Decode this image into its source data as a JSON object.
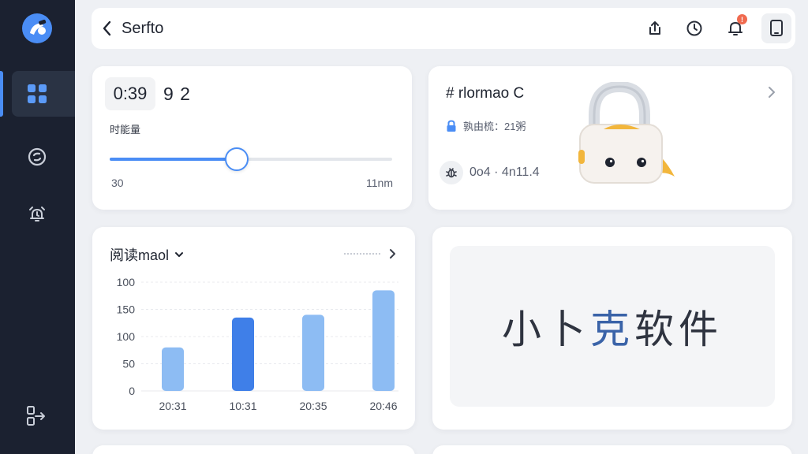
{
  "header": {
    "title": "Serfto",
    "notification_badge": "!"
  },
  "timer_card": {
    "time_main": "0:39",
    "time_extra": "9 2",
    "label": "时能量",
    "slider": {
      "min_label": "30",
      "max_label": "11nm",
      "value_fraction": 0.45
    }
  },
  "info_card": {
    "title": "# rlormao C",
    "row1_text": "孰由梳：21粥",
    "row2_text": "0o4 · 4n11.4"
  },
  "chart_card": {
    "title": "阅读maol"
  },
  "chart_data": {
    "type": "bar",
    "categories": [
      "20:31",
      "10:31",
      "20:35",
      "20:46"
    ],
    "values": [
      80,
      135,
      140,
      185
    ],
    "highlight_index": 1,
    "yticks": [
      0,
      50,
      100,
      150,
      100
    ],
    "ylim": [
      0,
      200
    ],
    "grid": true,
    "colors": {
      "bar": "#8dbcf3",
      "bar_highlight": "#3f7fe8"
    }
  },
  "brand_card": {
    "text_part1": "小卜",
    "text_accent": "克",
    "text_part2": "软件"
  },
  "colors": {
    "sidebar": "#1b2130",
    "accent": "#4a8df5",
    "badge": "#f06a4f",
    "background": "#eef0f4"
  },
  "icons": {
    "sidebar": [
      "logo-icon",
      "dashboard-icon",
      "refresh-circle-icon",
      "alarm-icon",
      "logout-icon"
    ],
    "topbar": [
      "back-chevron-icon",
      "share-icon",
      "clock-icon",
      "bell-icon",
      "tablet-icon"
    ]
  }
}
